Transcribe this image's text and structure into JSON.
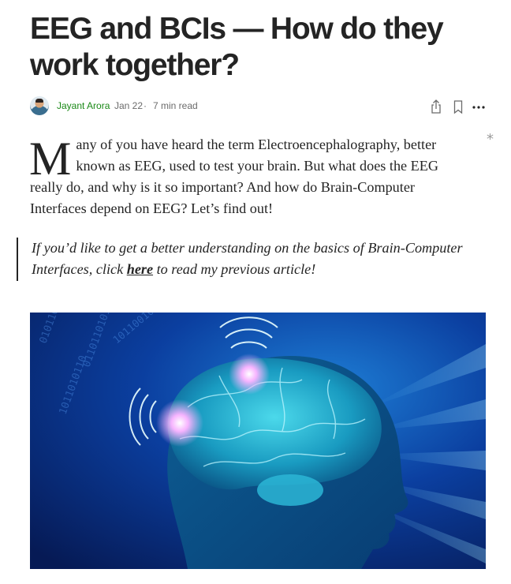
{
  "article": {
    "title": "EEG and BCIs — How do they work together?",
    "author": "Jayant Arora",
    "date": "Jan 22",
    "separator": "·",
    "read_time": "7 min read",
    "side_marker": "*",
    "dropcap": "M",
    "paragraph_rest": "any of you have heard the term Electroencephalography, better known as EEG, used to test your brain. But what does the EEG really do, and why is it so important? And how do Brain-Computer Interfaces depend on EEG? Let’s find out!",
    "quote": {
      "before": "If you’d like to get a better understanding on the basics of Brain-Computer Interfaces, click ",
      "link": "here",
      "after": " to read my previous article!"
    }
  },
  "actions": {
    "share_icon": "share-icon",
    "bookmark_icon": "bookmark-icon",
    "more_icon": "more-icon"
  },
  "colors": {
    "author_link": "#1a8917",
    "text": "#242424",
    "muted": "#6b6b6b"
  },
  "image": {
    "subject": "brain-scan-illustration"
  }
}
